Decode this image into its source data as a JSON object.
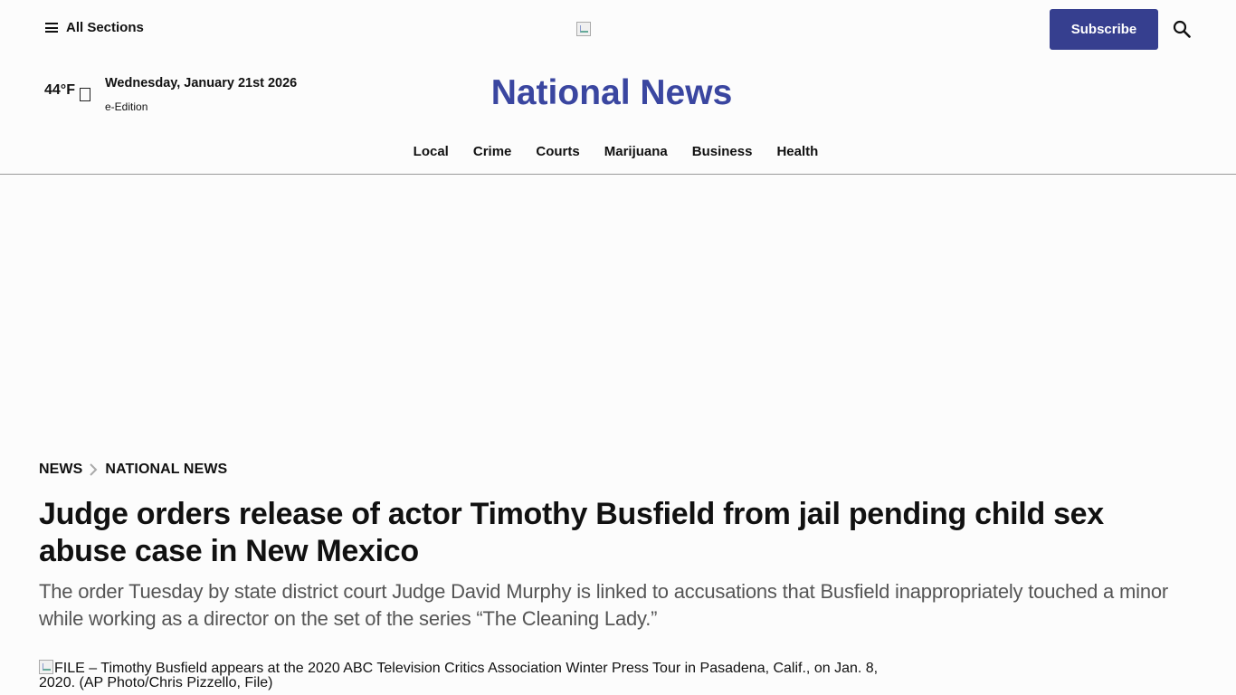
{
  "header": {
    "menu_label": "All Sections",
    "subscribe_label": "Subscribe"
  },
  "weather": {
    "temp": "44°F"
  },
  "date": "Wednesday, January 21st 2026",
  "eedition": "e-Edition",
  "site_title": "National News",
  "nav": [
    "Local",
    "Crime",
    "Courts",
    "Marijuana",
    "Business",
    "Health"
  ],
  "breadcrumb": {
    "section": "NEWS",
    "subsection": "NATIONAL NEWS"
  },
  "article": {
    "headline": "Judge orders release of actor Timothy Busfield from jail pending child sex abuse case in New Mexico",
    "dek": "The order Tuesday by state district court Judge David Murphy is linked to accusations that Busfield inappropriately touched a minor while working as a director on the set of the series “The Cleaning Lady.”",
    "image_alt": "FILE – Timothy Busfield appears at the 2020 ABC Television Critics Association Winter Press Tour in Pasadena, Calif., on Jan. 8, 2020. (AP Photo/Chris Pizzello, File)"
  },
  "colors": {
    "brand": "#363f8f",
    "title": "#3a46a0"
  }
}
